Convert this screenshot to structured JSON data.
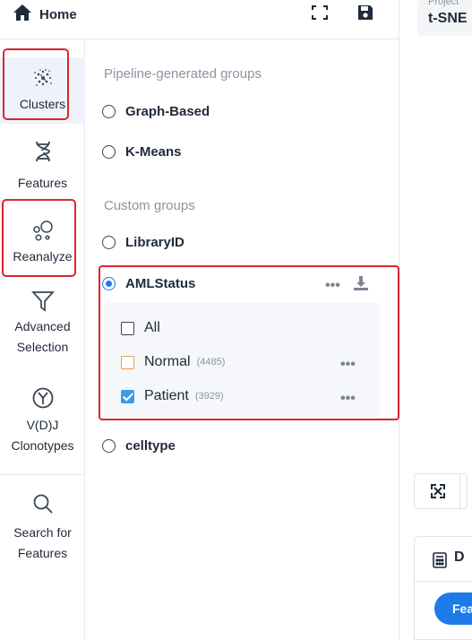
{
  "topbar": {
    "home_label": "Home",
    "home_icon": "home-icon",
    "fullscreen_icon": "fullscreen-icon",
    "save_icon": "save-icon"
  },
  "nav": {
    "items": [
      {
        "label": "Clusters",
        "icon": "clusters-icon"
      },
      {
        "label": "Features",
        "icon": "dna-icon"
      },
      {
        "label": "Reanalyze",
        "icon": "bubbles-icon"
      },
      {
        "label": "Advanced\nSelection",
        "icon": "filter-icon"
      },
      {
        "label": "V(D)J\nClonotypes",
        "icon": "antibody-icon"
      },
      {
        "label": "Search for\nFeatures",
        "icon": "search-icon"
      }
    ]
  },
  "groups": {
    "pipeline_title": "Pipeline-generated groups",
    "pipeline": [
      "Graph-Based",
      "K-Means"
    ],
    "custom_title": "Custom groups",
    "library_id": "LibraryID",
    "aml_status": "AMLStatus",
    "celltype": "celltype",
    "aml_items": [
      {
        "label": "All",
        "count": ""
      },
      {
        "label": "Normal",
        "count": "(4485)"
      },
      {
        "label": "Patient",
        "count": "(3929)"
      }
    ]
  },
  "right": {
    "project_label": "Project",
    "project_value": "t-SNE",
    "tab_label": "D",
    "button_label": "Fea"
  },
  "colors": {
    "accent": "#1d7ae8",
    "highlight": "#d9262c",
    "normal_swatch": "#e8a13c",
    "patient_swatch": "#3a9ce8"
  }
}
